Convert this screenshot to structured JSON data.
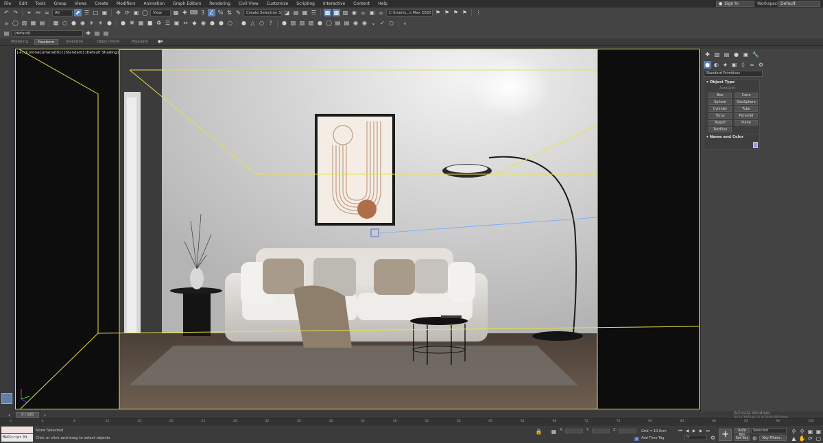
{
  "menu": {
    "items": [
      "File",
      "Edit",
      "Tools",
      "Group",
      "Views",
      "Create",
      "Modifiers",
      "Animation",
      "Graph Editors",
      "Rendering",
      "Civil View",
      "Customize",
      "Scripting",
      "Interactive",
      "Content",
      "Help"
    ],
    "sign_in": "Sign In",
    "workspaces_label": "Workspaces:",
    "workspace_value": "Default"
  },
  "toolbar1": {
    "selection_filter": "All",
    "ref_coord": "View",
    "named_selection": "Create Selection Se",
    "project_path": "C:\\Users\\...s Max 2020"
  },
  "toolbar3": {
    "layer": "(default)"
  },
  "ribbon": {
    "tabs": [
      "Modeling",
      "Freeform",
      "Selection",
      "Object Paint",
      "Populate"
    ]
  },
  "viewport": {
    "label": "[+] [CoronaCamera001] [Standard] [Default Shading]"
  },
  "command_panel": {
    "dropdown": "Standard Primitives",
    "object_type_title": "Object Type",
    "autogrid": "AutoGrid",
    "buttons": [
      "Box",
      "Cone",
      "Sphere",
      "GeoSphere",
      "Cylinder",
      "Tube",
      "Torus",
      "Pyramid",
      "Teapot",
      "Plane",
      "TextPlus"
    ],
    "name_color_title": "Name and Color"
  },
  "timeline": {
    "frame_readout": "0 / 100",
    "ticks": [
      "0",
      "4",
      "8",
      "12",
      "16",
      "20",
      "24",
      "28",
      "32",
      "36",
      "40",
      "44",
      "48",
      "52",
      "56",
      "60",
      "64",
      "68",
      "72",
      "76",
      "80",
      "84",
      "88",
      "92",
      "96",
      "100"
    ]
  },
  "status": {
    "maxscript_label": "MAXScript Mi",
    "selection": "None Selected",
    "prompt": "Click or click-and-drag to select objects",
    "x_label": "X:",
    "y_label": "Y:",
    "z_label": "Z:",
    "grid": "Grid = 10.0cm",
    "add_time_tag": "Add Time Tag",
    "auto_key": "Auto Key",
    "set_key": "Set Key",
    "selected_dropdown": "Selected",
    "key_filters": "Key Filters...",
    "frame_field": "0"
  },
  "watermark": {
    "title": "Activate Windows",
    "subtitle": "Go to Settings to activate Windows."
  },
  "colors": {
    "viewport_border": "#e6e24a",
    "accent_blue": "#5b7fb8",
    "object_color": "#a58fe6"
  }
}
